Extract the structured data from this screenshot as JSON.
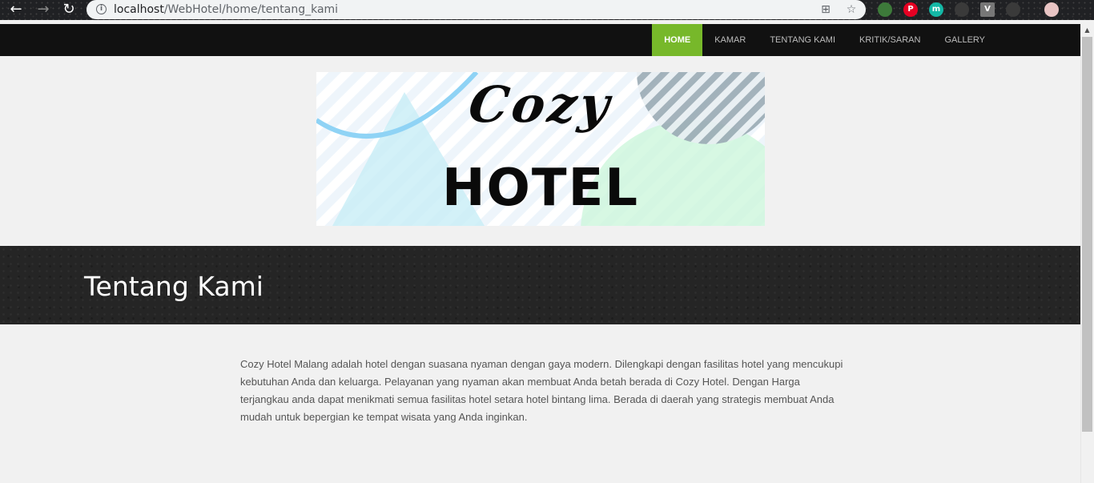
{
  "browser": {
    "url_host": "localhost",
    "url_path": "/WebHotel/home/tentang_kami",
    "back_icon": "arrow-left-icon",
    "forward_icon": "arrow-right-icon",
    "reload_icon": "reload-icon",
    "extension_m_label": "m"
  },
  "nav": {
    "items": [
      {
        "label": "HOME",
        "active": true
      },
      {
        "label": "KAMAR",
        "active": false
      },
      {
        "label": "TENTANG KAMI",
        "active": false
      },
      {
        "label": "KRITIK/SARAN",
        "active": false
      },
      {
        "label": "GALLERY",
        "active": false
      }
    ],
    "active_color": "#77b82a"
  },
  "logo": {
    "script_text": "Cozy",
    "main_text": "HOTEL"
  },
  "page": {
    "title": "Tentang Kami",
    "body": "Cozy Hotel Malang adalah hotel dengan suasana nyaman dengan gaya modern. Dilengkapi dengan fasilitas hotel yang mencukupi kebutuhan Anda dan keluarga. Pelayanan yang nyaman akan membuat Anda betah berada di Cozy Hotel. Dengan Harga terjangkau anda dapat menikmati semua fasilitas hotel setara hotel bintang lima. Berada di daerah yang strategis membuat Anda mudah untuk bepergian ke tempat wisata yang Anda inginkan."
  }
}
